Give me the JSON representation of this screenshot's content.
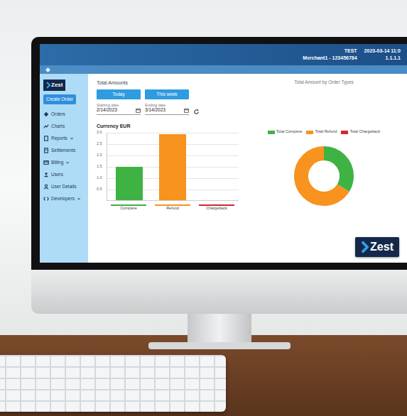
{
  "header": {
    "env": "TEST",
    "datetime": "2023-03-14 11:0",
    "merchant": "Merchant1 - 123456784",
    "ip": "1.1.1.1"
  },
  "sidebar": {
    "logo": "Zest",
    "create_button": "Create Order",
    "items": [
      {
        "label": "Orders",
        "kind": "link"
      },
      {
        "label": "Charts",
        "kind": "link"
      },
      {
        "label": "Reports",
        "kind": "group"
      },
      {
        "label": "Settlements",
        "kind": "link"
      },
      {
        "label": "Billing",
        "kind": "group"
      },
      {
        "label": "Users",
        "kind": "link"
      },
      {
        "label": "User Details",
        "kind": "link"
      },
      {
        "label": "Developers",
        "kind": "group"
      }
    ]
  },
  "filters": {
    "title": "Total Amounts",
    "buttons": [
      {
        "label": "Today",
        "selected": false
      },
      {
        "label": "This week",
        "selected": false
      }
    ],
    "start": {
      "label": "Starting date",
      "value": "2/14/2023"
    },
    "end": {
      "label": "Ending date",
      "value": "3/14/2023"
    }
  },
  "bar_chart": {
    "title": "Currency EUR",
    "ticks": [
      "3.0",
      "2.5",
      "2.0",
      "1.5",
      "1.0",
      "0.5"
    ],
    "categories": [
      {
        "label": "Complete",
        "color": "#3fb244"
      },
      {
        "label": "Refund",
        "color": "#f7931e"
      },
      {
        "label": "Chargeback",
        "color": "#d3262e"
      }
    ],
    "values": [
      1.5,
      2.95,
      0
    ]
  },
  "donut_chart": {
    "title": "Total Amount by Order Types",
    "legend": [
      {
        "label": "Total Complete",
        "color": "#3fb244"
      },
      {
        "label": "Total Refund",
        "color": "#f7931e"
      },
      {
        "label": "Total Chargeback",
        "color": "#d3262e"
      }
    ],
    "values": [
      1.5,
      2.95,
      0
    ]
  },
  "badge": {
    "text": "Zest"
  }
}
